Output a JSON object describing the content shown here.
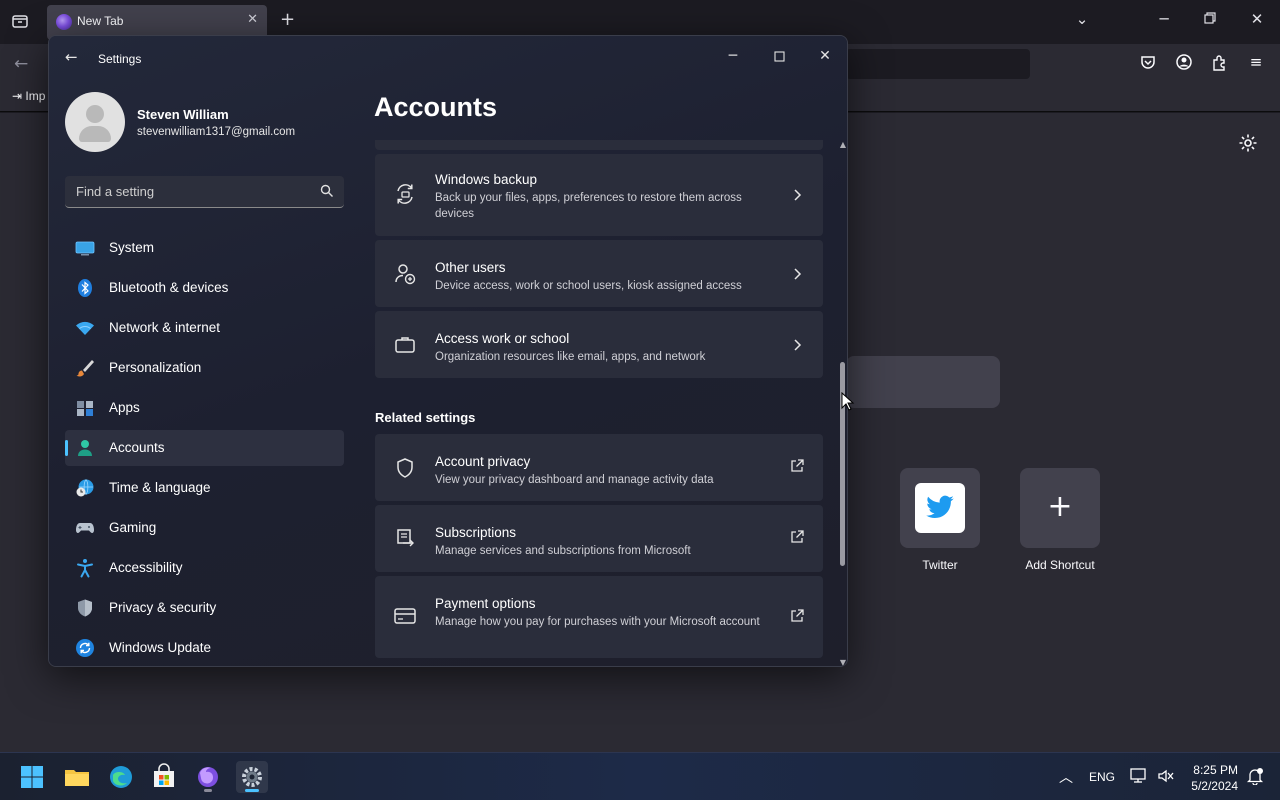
{
  "browser": {
    "tab_title": "New Tab",
    "bookmark_label": "Imp",
    "shortcuts": [
      {
        "label": "Twitter",
        "icon": "twitter-icon"
      },
      {
        "label": "Add Shortcut",
        "icon": "plus-icon"
      }
    ]
  },
  "settings": {
    "window_title": "Settings",
    "profile": {
      "name": "Steven William",
      "email": "stevenwilliam1317@gmail.com"
    },
    "search": {
      "placeholder": "Find a setting"
    },
    "nav": [
      {
        "label": "System",
        "icon": "monitor-icon"
      },
      {
        "label": "Bluetooth & devices",
        "icon": "bluetooth-icon"
      },
      {
        "label": "Network & internet",
        "icon": "wifi-icon"
      },
      {
        "label": "Personalization",
        "icon": "brush-icon"
      },
      {
        "label": "Apps",
        "icon": "apps-icon"
      },
      {
        "label": "Accounts",
        "icon": "person-icon",
        "active": true
      },
      {
        "label": "Time & language",
        "icon": "globe-clock-icon"
      },
      {
        "label": "Gaming",
        "icon": "gamepad-icon"
      },
      {
        "label": "Accessibility",
        "icon": "accessibility-icon"
      },
      {
        "label": "Privacy & security",
        "icon": "shield-icon"
      },
      {
        "label": "Windows Update",
        "icon": "update-icon"
      }
    ],
    "page_title": "Accounts",
    "cards": [
      {
        "title": "Windows backup",
        "desc": "Back up your files, apps, preferences to restore them across devices",
        "icon": "backup-icon",
        "action": "chevron-right-icon"
      },
      {
        "title": "Other users",
        "desc": "Device access, work or school users, kiosk assigned access",
        "icon": "add-user-icon",
        "action": "chevron-right-icon"
      },
      {
        "title": "Access work or school",
        "desc": "Organization resources like email, apps, and network",
        "icon": "briefcase-icon",
        "action": "chevron-right-icon"
      }
    ],
    "related_label": "Related settings",
    "related": [
      {
        "title": "Account privacy",
        "desc": "View your privacy dashboard and manage activity data",
        "icon": "shield-outline-icon",
        "action": "external-link-icon"
      },
      {
        "title": "Subscriptions",
        "desc": "Manage services and subscriptions from Microsoft",
        "icon": "subscriptions-icon",
        "action": "external-link-icon"
      },
      {
        "title": "Payment options",
        "desc": "Manage how you pay for purchases with your Microsoft account",
        "icon": "credit-card-icon",
        "action": "external-link-icon"
      }
    ]
  },
  "taskbar": {
    "apps": [
      "windows-start-icon",
      "file-explorer-icon",
      "edge-icon",
      "store-icon",
      "firefox-icon",
      "settings-icon"
    ],
    "language": "ENG",
    "time": "8:25 PM",
    "date": "5/2/2024"
  },
  "colors": {
    "accent": "#4cc2ff",
    "window_bg": "#1f2230",
    "card_bg": "#2a2d3b"
  }
}
